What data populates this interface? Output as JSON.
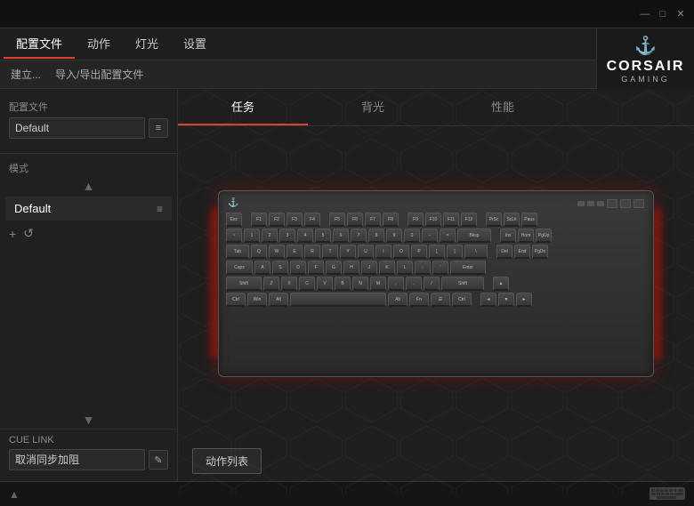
{
  "titleBar": {
    "minBtn": "—",
    "maxBtn": "□",
    "closeBtn": "✕"
  },
  "menuBar": {
    "items": [
      {
        "label": "配置文件",
        "active": true
      },
      {
        "label": "动作",
        "active": false
      },
      {
        "label": "灯光",
        "active": false
      },
      {
        "label": "设置",
        "active": false
      }
    ]
  },
  "logo": {
    "brand": "CORSAIR",
    "sub": "GAMING",
    "icon": "⚓"
  },
  "subBar": {
    "build": "建立...",
    "importExport": "导入/导出配置文件"
  },
  "sidebar": {
    "profileLabel": "配置文件",
    "profileDefault": "Default",
    "modeLabel": "模式",
    "modeDefault": "Default",
    "addBtn": "+",
    "restoreBtn": "↺",
    "cueLinkLabel": "CUE LINK",
    "cueLinkValue": "取消同步加阻"
  },
  "contentTabs": [
    {
      "label": "任务",
      "active": true
    },
    {
      "label": "背光",
      "active": false
    },
    {
      "label": "性能",
      "active": false
    }
  ],
  "keyboard": {
    "logo": "⚓",
    "actionListBtn": "动作列表"
  },
  "bottomBar": {
    "chevronUp": "▲"
  }
}
